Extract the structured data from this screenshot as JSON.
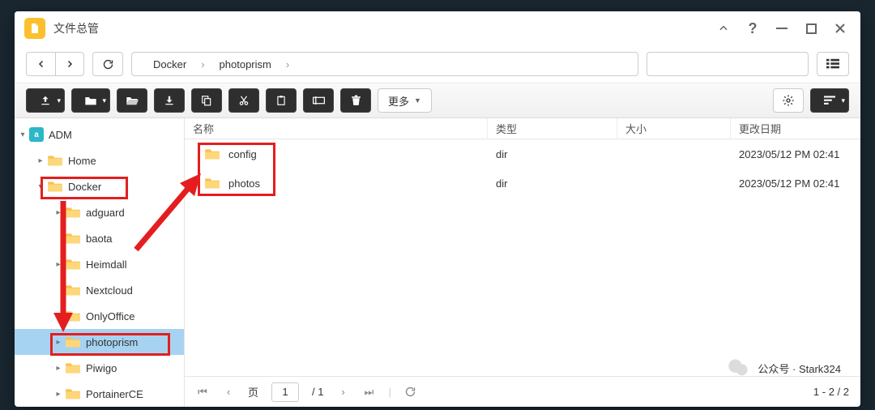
{
  "window_title": "文件总管",
  "breadcrumb": [
    "Docker",
    "photoprism"
  ],
  "search_placeholder": "",
  "more_label": "更多",
  "tree": {
    "root": "ADM",
    "items": [
      {
        "label": "Home",
        "depth": 1,
        "expander": "▸"
      },
      {
        "label": "Docker",
        "depth": 1,
        "expander": "▾",
        "boxed": true
      },
      {
        "label": "adguard",
        "depth": 2,
        "expander": "▸"
      },
      {
        "label": "baota",
        "depth": 2,
        "expander": ""
      },
      {
        "label": "Heimdall",
        "depth": 2,
        "expander": "▸"
      },
      {
        "label": "Nextcloud",
        "depth": 2,
        "expander": ""
      },
      {
        "label": "OnlyOffice",
        "depth": 2,
        "expander": "▸"
      },
      {
        "label": "photoprism",
        "depth": 2,
        "expander": "▸",
        "selected": true,
        "boxed": true
      },
      {
        "label": "Piwigo",
        "depth": 2,
        "expander": "▸"
      },
      {
        "label": "PortainerCE",
        "depth": 2,
        "expander": "▸"
      }
    ]
  },
  "columns": {
    "name": "名称",
    "type": "类型",
    "size": "大小",
    "date": "更改日期"
  },
  "rows": [
    {
      "name": "config",
      "type": "dir",
      "size": "",
      "date": "2023/05/12 PM 02:41"
    },
    {
      "name": "photos",
      "type": "dir",
      "size": "",
      "date": "2023/05/12 PM 02:41"
    }
  ],
  "pager": {
    "page_label": "页",
    "current": "1",
    "total": "/ 1",
    "range": "1 - 2 / 2"
  },
  "watermark": "公众号 · Stark324"
}
